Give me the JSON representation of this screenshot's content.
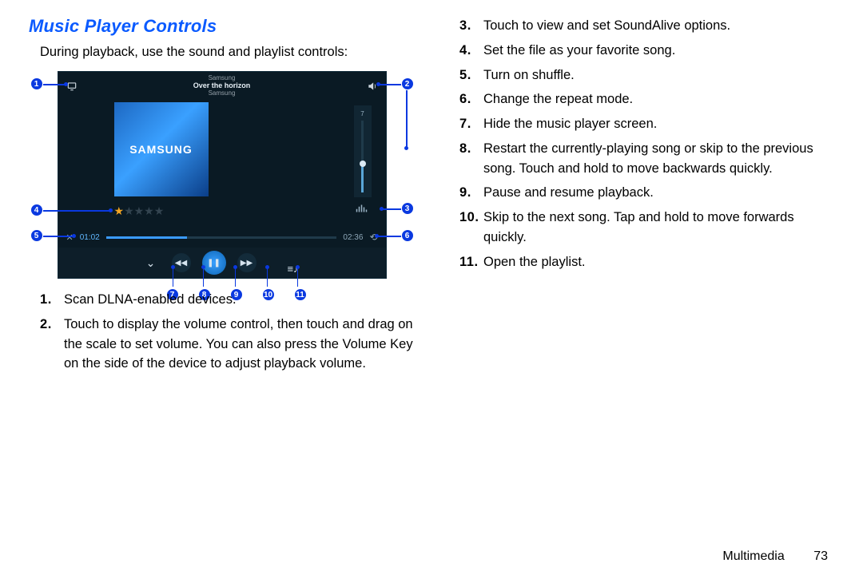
{
  "heading": "Music Player Controls",
  "intro": "During playback, use the sound and playlist controls:",
  "figure": {
    "song_artist_top": "Samsung",
    "song_title": "Over the horizon",
    "song_artist_bottom": "Samsung",
    "album_brand": "SAMSUNG",
    "volume_level": "7",
    "elapsed": "01:02",
    "duration": "02:36"
  },
  "labels": [
    "1",
    "2",
    "3",
    "4",
    "5",
    "6",
    "7",
    "8",
    "9",
    "10",
    "11"
  ],
  "left_items": [
    "Scan DLNA-enabled devices.",
    "Touch to display the volume control, then touch and drag on the scale to set volume. You can also press the Volume Key on the side of the device to adjust playback volume."
  ],
  "right_items": [
    "Touch to view and set SoundAlive options.",
    "Set the file as your favorite song.",
    "Turn on shuffle.",
    "Change the repeat mode.",
    "Hide the music player screen.",
    "Restart the currently-playing song or skip to the previous song. Touch and hold to move backwards quickly.",
    "Pause and resume playback.",
    "Skip to the next song. Tap and hold to move forwards quickly.",
    "Open the playlist."
  ],
  "footer": {
    "section": "Multimedia",
    "page": "73"
  }
}
